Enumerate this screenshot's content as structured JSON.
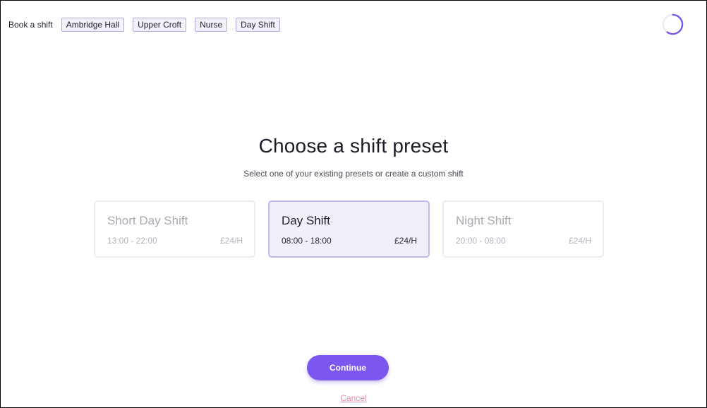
{
  "breadcrumb": {
    "label": "Book a shift",
    "chips": [
      "Ambridge Hall",
      "Upper Croft",
      "Nurse",
      "Day Shift"
    ]
  },
  "loading_indicator": {
    "icon": "spinner-icon",
    "color": "#7b57ee"
  },
  "main": {
    "title": "Choose a shift preset",
    "subtitle": "Select one of your existing presets or create a custom shift"
  },
  "presets": [
    {
      "name": "Short Day Shift",
      "time": "13:00 - 22:00",
      "rate": "£24/H",
      "selected": false
    },
    {
      "name": "Day Shift",
      "time": "08:00 - 18:00",
      "rate": "£24/H",
      "selected": true
    },
    {
      "name": "Night Shift",
      "time": "20:00 - 08:00",
      "rate": "£24/H",
      "selected": false
    }
  ],
  "actions": {
    "continue_label": "Continue",
    "cancel_label": "Cancel"
  },
  "colors": {
    "accent": "#7b57ee",
    "chip_border": "#b4a6e3",
    "selected_card_bg": "#f2effb",
    "cancel_link": "#e28ab0"
  }
}
